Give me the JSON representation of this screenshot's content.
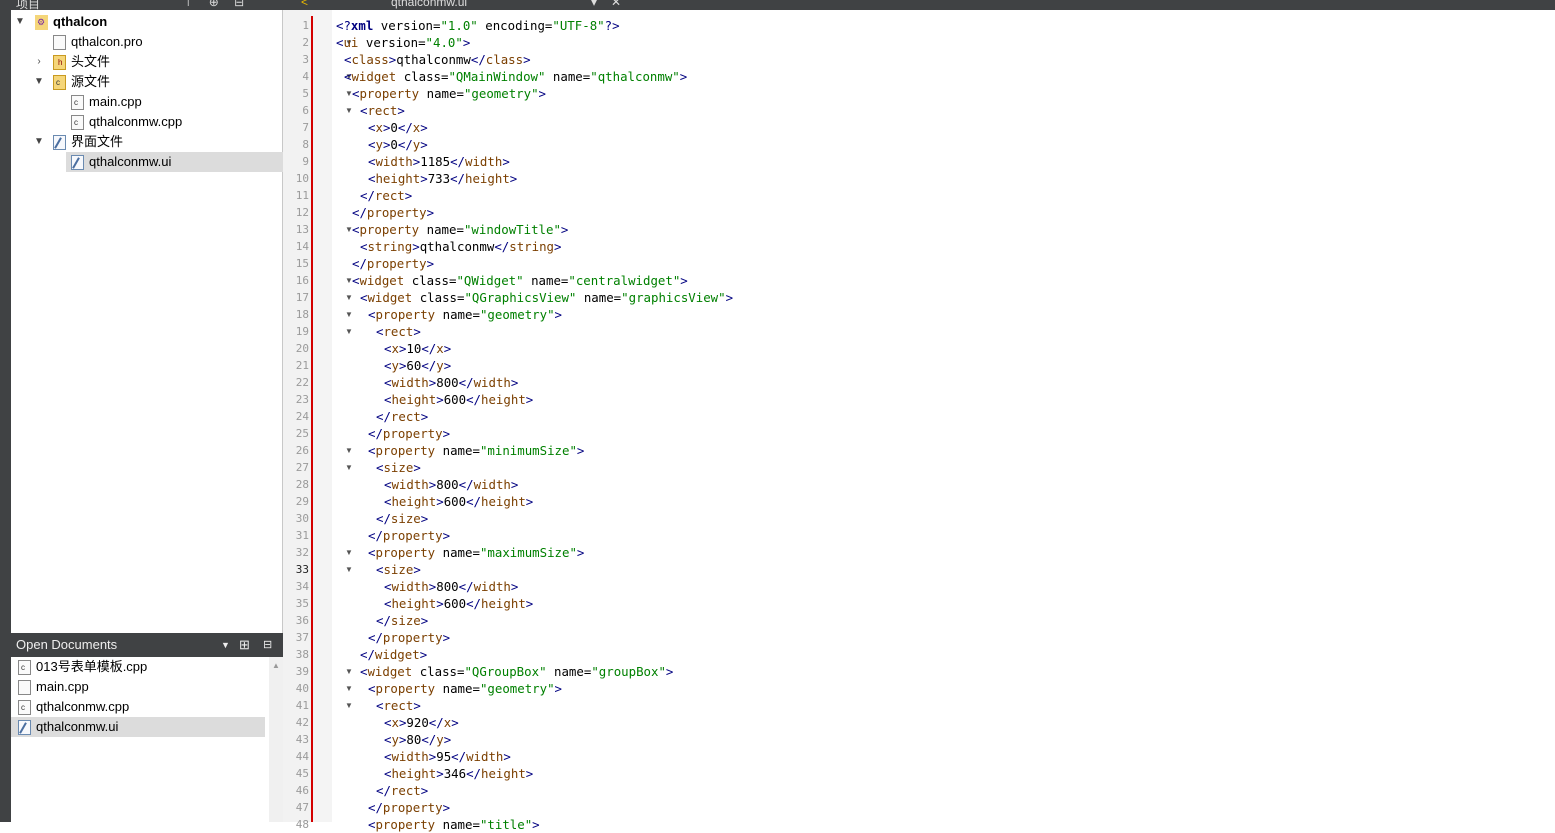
{
  "topbar": {
    "project_label": "项目",
    "file_tab": "qthalconmw.ui",
    "nav_back": "<",
    "icons": "⊤ ⊕ ⊟"
  },
  "tree": {
    "root": "qthalcon",
    "pro": "qthalcon.pro",
    "headers": "头文件",
    "sources": "源文件",
    "main": "main.cpp",
    "mwcpp": "qthalconmw.cpp",
    "forms": "界面文件",
    "ui": "qthalconmw.ui"
  },
  "open_documents": {
    "title": "Open Documents",
    "items": [
      "013号表单模板.cpp",
      "main.cpp",
      "qthalconmw.cpp",
      "qthalconmw.ui"
    ]
  },
  "editor": {
    "current_line": 33,
    "fold_lines": [
      2,
      4,
      5,
      6,
      13,
      16,
      17,
      18,
      19,
      26,
      27,
      32,
      33,
      39,
      40,
      41
    ],
    "lines": [
      "<?xml version=\"1.0\" encoding=\"UTF-8\"?>",
      "<ui version=\"4.0\">",
      " <class>qthalconmw</class>",
      " <widget class=\"QMainWindow\" name=\"qthalconmw\">",
      "  <property name=\"geometry\">",
      "   <rect>",
      "    <x>0</x>",
      "    <y>0</y>",
      "    <width>1185</width>",
      "    <height>733</height>",
      "   </rect>",
      "  </property>",
      "  <property name=\"windowTitle\">",
      "   <string>qthalconmw</string>",
      "  </property>",
      "  <widget class=\"QWidget\" name=\"centralwidget\">",
      "   <widget class=\"QGraphicsView\" name=\"graphicsView\">",
      "    <property name=\"geometry\">",
      "     <rect>",
      "      <x>10</x>",
      "      <y>60</y>",
      "      <width>800</width>",
      "      <height>600</height>",
      "     </rect>",
      "    </property>",
      "    <property name=\"minimumSize\">",
      "     <size>",
      "      <width>800</width>",
      "      <height>600</height>",
      "     </size>",
      "    </property>",
      "    <property name=\"maximumSize\">",
      "     <size>",
      "      <width>800</width>",
      "      <height>600</height>",
      "     </size>",
      "    </property>",
      "   </widget>",
      "   <widget class=\"QGroupBox\" name=\"groupBox\">",
      "    <property name=\"geometry\">",
      "     <rect>",
      "      <x>920</x>",
      "      <y>80</y>",
      "      <width>95</width>",
      "      <height>346</height>",
      "     </rect>",
      "    </property>",
      "    <property name=\"title\">"
    ]
  }
}
